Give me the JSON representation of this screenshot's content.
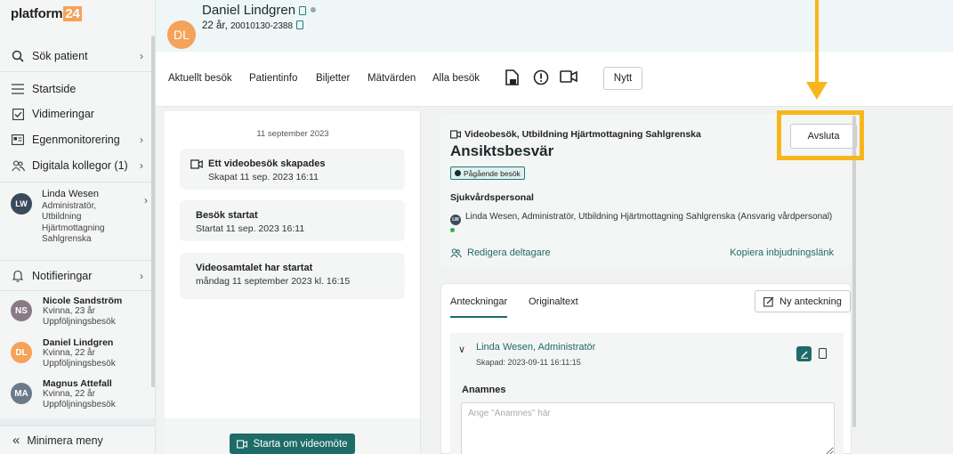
{
  "sidebar": {
    "logo_text": "platform",
    "logo_num": "24",
    "search": "Sök patient",
    "start": "Startside",
    "vidimeringar": "Vidimeringar",
    "egenmonitorering": "Egenmonitorering",
    "digitala": "Digitala kollegor (1)",
    "user": {
      "initials": "LW",
      "name": "Linda Wesen",
      "role_l1": "Administratör,",
      "role_l2": "Utbildning",
      "role_l3": "Hjärtmottagning",
      "role_l4": "Sahlgrenska"
    },
    "notifieringar": "Notifieringar",
    "patients": [
      {
        "initials": "NS",
        "name": "Nicole Sandström",
        "info": "Kvinna, 23 år",
        "type": "Uppföljningsbesök",
        "color": "#8a7a88"
      },
      {
        "initials": "DL",
        "name": "Daniel Lindgren",
        "info": "Kvinna, 22 år",
        "type": "Uppföljningsbesök",
        "color": "#f5a25a"
      },
      {
        "initials": "MA",
        "name": "Magnus Attefall",
        "info": "Kvinna, 22 år",
        "type": "Uppföljningsbesök",
        "color": "#6a7a8a"
      }
    ],
    "minimize": "Minimera meny"
  },
  "header": {
    "initials": "DL",
    "name": "Daniel Lindgren",
    "age": "22 år,",
    "pnr": "20010130-2388"
  },
  "nav": {
    "tabs": [
      "Aktuellt besök",
      "Patientinfo",
      "Biljetter",
      "Mätvärden",
      "Alla besök"
    ],
    "new_btn": "Nytt"
  },
  "timeline": {
    "date": "11 september 2023",
    "events": [
      {
        "title": "Ett videobesök skapades",
        "sub": "Skapat 11 sep. 2023 16:11"
      },
      {
        "title": "Besök startat",
        "sub": "Startat 11 sep. 2023 16:11"
      },
      {
        "title": "Videosamtalet har startat",
        "sub": "måndag 11 september 2023 kl. 16:15"
      }
    ],
    "restart_btn": "Starta om videomöte"
  },
  "visit": {
    "type": "Videobesök, Utbildning Hjärtmottagning Sahlgrenska",
    "title": "Ansiktsbesvär",
    "status": "Pågående besök",
    "staff_header": "Sjukvårdspersonal",
    "staff_initials": "LW",
    "staff": "Linda Wesen, Administratör, Utbildning Hjärtmottagning Sahlgrenska (Ansvarig vårdpersonal)",
    "edit": "Redigera deltagare",
    "invite": "Kopiera inbjudningslänk",
    "end_btn": "Avsluta"
  },
  "notes": {
    "tab_notes": "Anteckningar",
    "tab_original": "Originaltext",
    "new_note_btn": "Ny anteckning",
    "author": "Linda Wesen, Administratör",
    "created": "Skapad: 2023-09-11 16:11:15",
    "anamnes_header": "Anamnes",
    "anamnes_placeholder": "Ange \"Anamnes\" här"
  },
  "colors": {
    "accent": "#1e6b67",
    "highlight": "#f7b71c"
  }
}
